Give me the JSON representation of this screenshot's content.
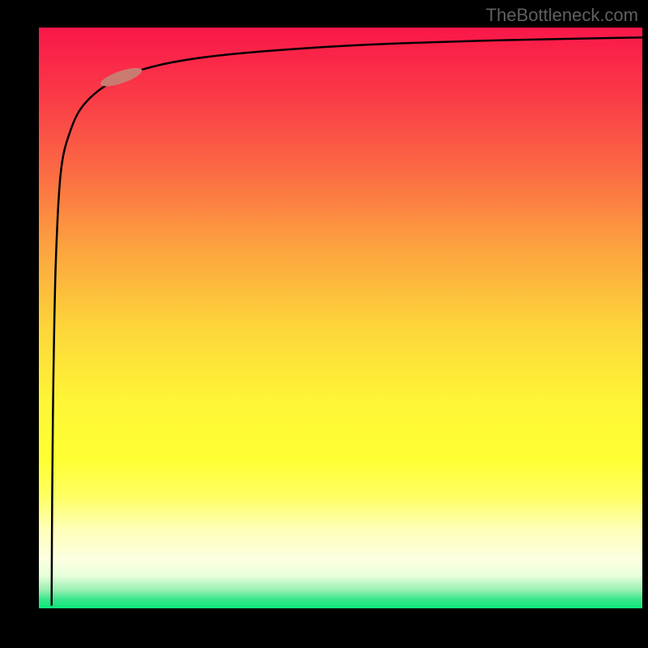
{
  "watermark": "TheBottleneck.com",
  "chart_data": {
    "type": "line",
    "title": "",
    "xlabel": "",
    "ylabel": "",
    "xlim": [
      0,
      100
    ],
    "ylim": [
      0,
      100
    ],
    "background_gradient": {
      "type": "vertical",
      "stops": [
        {
          "position": 0,
          "color": "#f91749"
        },
        {
          "position": 12,
          "color": "#fa3b47"
        },
        {
          "position": 24,
          "color": "#fb6844"
        },
        {
          "position": 38,
          "color": "#fca43f"
        },
        {
          "position": 52,
          "color": "#fdd73a"
        },
        {
          "position": 64,
          "color": "#fef536"
        },
        {
          "position": 74,
          "color": "#ffff33"
        },
        {
          "position": 80,
          "color": "#ffff5e"
        },
        {
          "position": 86,
          "color": "#feffb8"
        },
        {
          "position": 91,
          "color": "#fdffe0"
        },
        {
          "position": 94,
          "color": "#e8ffdc"
        },
        {
          "position": 96.5,
          "color": "#96efb0"
        },
        {
          "position": 98,
          "color": "#3ae68c"
        },
        {
          "position": 100,
          "color": "#00e676"
        }
      ]
    },
    "series": [
      {
        "name": "curve",
        "type": "logarithmic",
        "points": [
          {
            "x": 2.5,
            "y": 1
          },
          {
            "x": 2.6,
            "y": 20
          },
          {
            "x": 2.8,
            "y": 40
          },
          {
            "x": 3.2,
            "y": 60
          },
          {
            "x": 4.0,
            "y": 75
          },
          {
            "x": 5.5,
            "y": 82
          },
          {
            "x": 8.0,
            "y": 87
          },
          {
            "x": 13,
            "y": 91
          },
          {
            "x": 20,
            "y": 93.5
          },
          {
            "x": 30,
            "y": 95.2
          },
          {
            "x": 45,
            "y": 96.5
          },
          {
            "x": 60,
            "y": 97.3
          },
          {
            "x": 80,
            "y": 97.9
          },
          {
            "x": 100,
            "y": 98.3
          }
        ]
      }
    ],
    "marker": {
      "x": 14,
      "y": 91.5,
      "shape": "pill",
      "color": "#c97b71",
      "rotation": -19
    }
  }
}
